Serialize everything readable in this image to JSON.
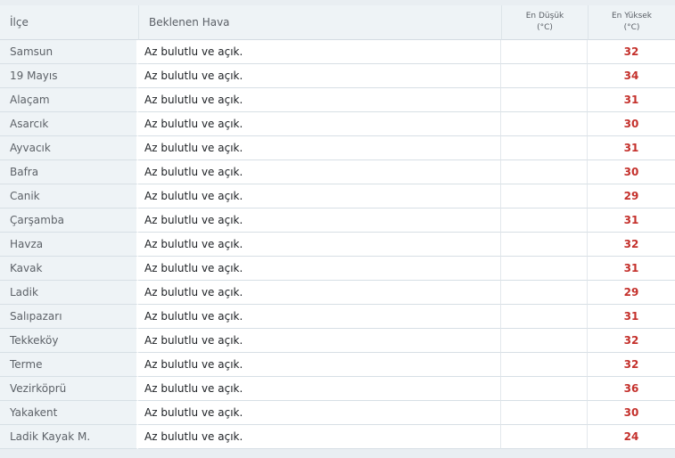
{
  "header": {
    "ilce": "İlçe",
    "hava": "Beklenen Hava",
    "min_line1": "En Düşük",
    "min_line2": "(°C)",
    "max_line1": "En Yüksek",
    "max_line2": "(°C)"
  },
  "rows": [
    {
      "ilce": "Samsun",
      "hava": "Az bulutlu ve açık.",
      "min": "",
      "max": "32"
    },
    {
      "ilce": "19 Mayıs",
      "hava": "Az bulutlu ve açık.",
      "min": "",
      "max": "34"
    },
    {
      "ilce": "Alaçam",
      "hava": "Az bulutlu ve açık.",
      "min": "",
      "max": "31"
    },
    {
      "ilce": "Asarcık",
      "hava": "Az bulutlu ve açık.",
      "min": "",
      "max": "30"
    },
    {
      "ilce": "Ayvacık",
      "hava": "Az bulutlu ve açık.",
      "min": "",
      "max": "31"
    },
    {
      "ilce": "Bafra",
      "hava": "Az bulutlu ve açık.",
      "min": "",
      "max": "30"
    },
    {
      "ilce": "Canik",
      "hava": "Az bulutlu ve açık.",
      "min": "",
      "max": "29"
    },
    {
      "ilce": "Çarşamba",
      "hava": "Az bulutlu ve açık.",
      "min": "",
      "max": "31"
    },
    {
      "ilce": "Havza",
      "hava": "Az bulutlu ve açık.",
      "min": "",
      "max": "32"
    },
    {
      "ilce": "Kavak",
      "hava": "Az bulutlu ve açık.",
      "min": "",
      "max": "31"
    },
    {
      "ilce": "Ladik",
      "hava": "Az bulutlu ve açık.",
      "min": "",
      "max": "29"
    },
    {
      "ilce": "Salıpazarı",
      "hava": "Az bulutlu ve açık.",
      "min": "",
      "max": "31"
    },
    {
      "ilce": "Tekkeköy",
      "hava": "Az bulutlu ve açık.",
      "min": "",
      "max": "32"
    },
    {
      "ilce": "Terme",
      "hava": "Az bulutlu ve açık.",
      "min": "",
      "max": "32"
    },
    {
      "ilce": "Vezirköprü",
      "hava": "Az bulutlu ve açık.",
      "min": "",
      "max": "36"
    },
    {
      "ilce": "Yakakent",
      "hava": "Az bulutlu ve açık.",
      "min": "",
      "max": "30"
    },
    {
      "ilce": "Ladik Kayak M.",
      "hava": "Az bulutlu ve açık.",
      "min": "",
      "max": "24"
    }
  ]
}
